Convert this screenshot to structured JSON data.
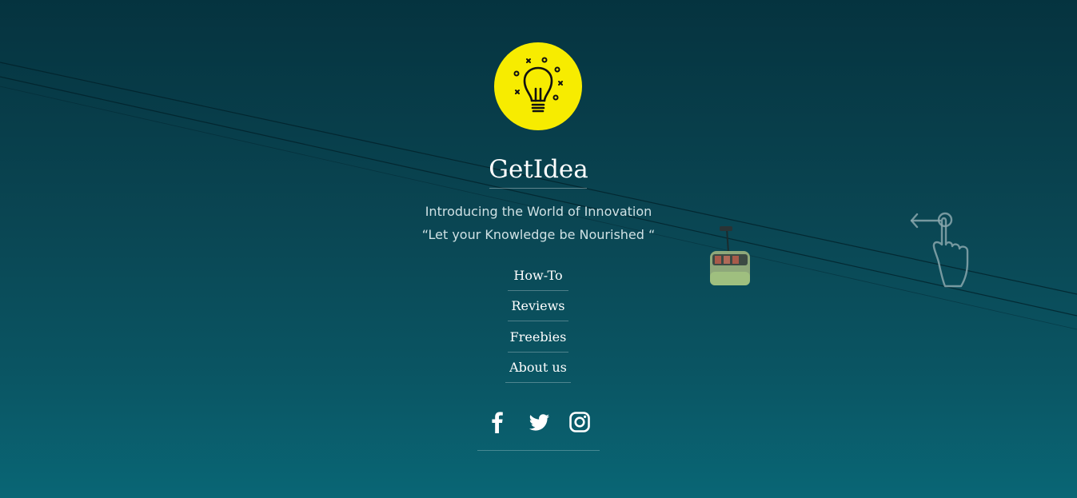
{
  "site": {
    "title": "GetIdea",
    "tagline_line1": "Introducing the World of Innovation",
    "tagline_line2": "“Let your Knowledge be Nourished “"
  },
  "logo": {
    "icon": "lightbulb-icon",
    "background_color": "#f7ec00"
  },
  "nav": {
    "items": [
      {
        "label": "How-To"
      },
      {
        "label": "Reviews"
      },
      {
        "label": "Freebies"
      },
      {
        "label": "About us"
      }
    ]
  },
  "social": {
    "items": [
      {
        "icon": "facebook-icon"
      },
      {
        "icon": "twitter-icon"
      },
      {
        "icon": "instagram-icon"
      }
    ]
  },
  "hint": {
    "icon": "swipe-left-icon"
  },
  "colors": {
    "background_top": "#05333f",
    "background_bottom": "#096675",
    "accent": "#f7ec00"
  }
}
